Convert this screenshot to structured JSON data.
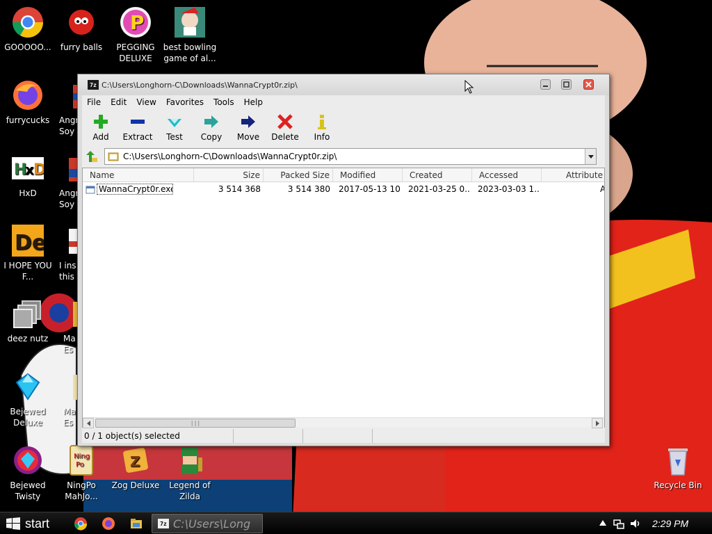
{
  "desktop": {
    "icons": [
      {
        "label": "GOOOOO...",
        "icon": "chrome-icon"
      },
      {
        "label": "furry balls",
        "icon": "furry-ball-icon"
      },
      {
        "label": "PEGGING DELUXE",
        "icon": "pegging-icon"
      },
      {
        "label": "best bowling game of al...",
        "icon": "bowling-icon"
      },
      {
        "label": "furrycucks",
        "icon": "firefox-icon"
      },
      {
        "label": "Angr Soy",
        "icon": "angry-icon"
      },
      {
        "label": "HxD",
        "icon": "hxd-icon"
      },
      {
        "label": "Angr Soy",
        "icon": "angry-soy-icon"
      },
      {
        "label": "I HOPE YOU F...",
        "icon": "de-icon"
      },
      {
        "label": "I ins this",
        "icon": "doc-icon"
      },
      {
        "label": "deez nutz",
        "icon": "shortcut-icon"
      },
      {
        "label": "Ma Es",
        "icon": "mahjong-icon"
      },
      {
        "label": "Bejewed Deluxe",
        "icon": "bejeweled-icon"
      },
      {
        "label": "Ma Es",
        "icon": "mahjong2-icon"
      },
      {
        "label": "Bejewed Twisty",
        "icon": "bejeweled-twist-icon"
      },
      {
        "label": "NingPo MahJo...",
        "icon": "ningpo-icon"
      },
      {
        "label": "Zog Deluxe",
        "icon": "zog-icon"
      },
      {
        "label": "Legend of Zilda",
        "icon": "zelda-icon"
      },
      {
        "label": "Recycle Bin",
        "icon": "recycle-bin-icon"
      }
    ]
  },
  "window": {
    "app_icon_text": "7z",
    "title": "C:\\Users\\Longhorn-C\\Downloads\\WannaCrypt0r.zip\\",
    "menu": [
      "File",
      "Edit",
      "View",
      "Favorites",
      "Tools",
      "Help"
    ],
    "toolbar": [
      {
        "label": "Add",
        "icon": "plus-icon",
        "color": "#22aa22"
      },
      {
        "label": "Extract",
        "icon": "minus-icon",
        "color": "#1133aa"
      },
      {
        "label": "Test",
        "icon": "check-icon",
        "color": "#22bbcc"
      },
      {
        "label": "Copy",
        "icon": "copy-arrow-icon",
        "color": "#2aa39a"
      },
      {
        "label": "Move",
        "icon": "move-arrow-icon",
        "color": "#14247a"
      },
      {
        "label": "Delete",
        "icon": "delete-x-icon",
        "color": "#dd2222"
      },
      {
        "label": "Info",
        "icon": "info-icon",
        "color": "#d8c21a"
      }
    ],
    "address": "C:\\Users\\Longhorn-C\\Downloads\\WannaCrypt0r.zip\\",
    "columns": [
      "Name",
      "Size",
      "Packed Size",
      "Modified",
      "Created",
      "Accessed",
      "Attribute"
    ],
    "rows": [
      {
        "name": "WannaCrypt0r.exe",
        "size": "3 514 368",
        "packed": "3 514 380",
        "modified": "2017-05-13 10...",
        "created": "2021-03-25 0...",
        "accessed": "2023-03-03 1...",
        "attribute": "A"
      }
    ],
    "scroll_thumb": "|||",
    "status": "0 / 1 object(s) selected"
  },
  "taskbar": {
    "start_label": "start",
    "task_label": "C:\\Users\\Long",
    "task_icon_text": "7z",
    "clock": "2:29 PM"
  },
  "colors": {
    "accent_close": "#e25a4a",
    "taskbar": "#000000",
    "flag_red": "#c6363c",
    "flag_blue": "#0c4076"
  }
}
